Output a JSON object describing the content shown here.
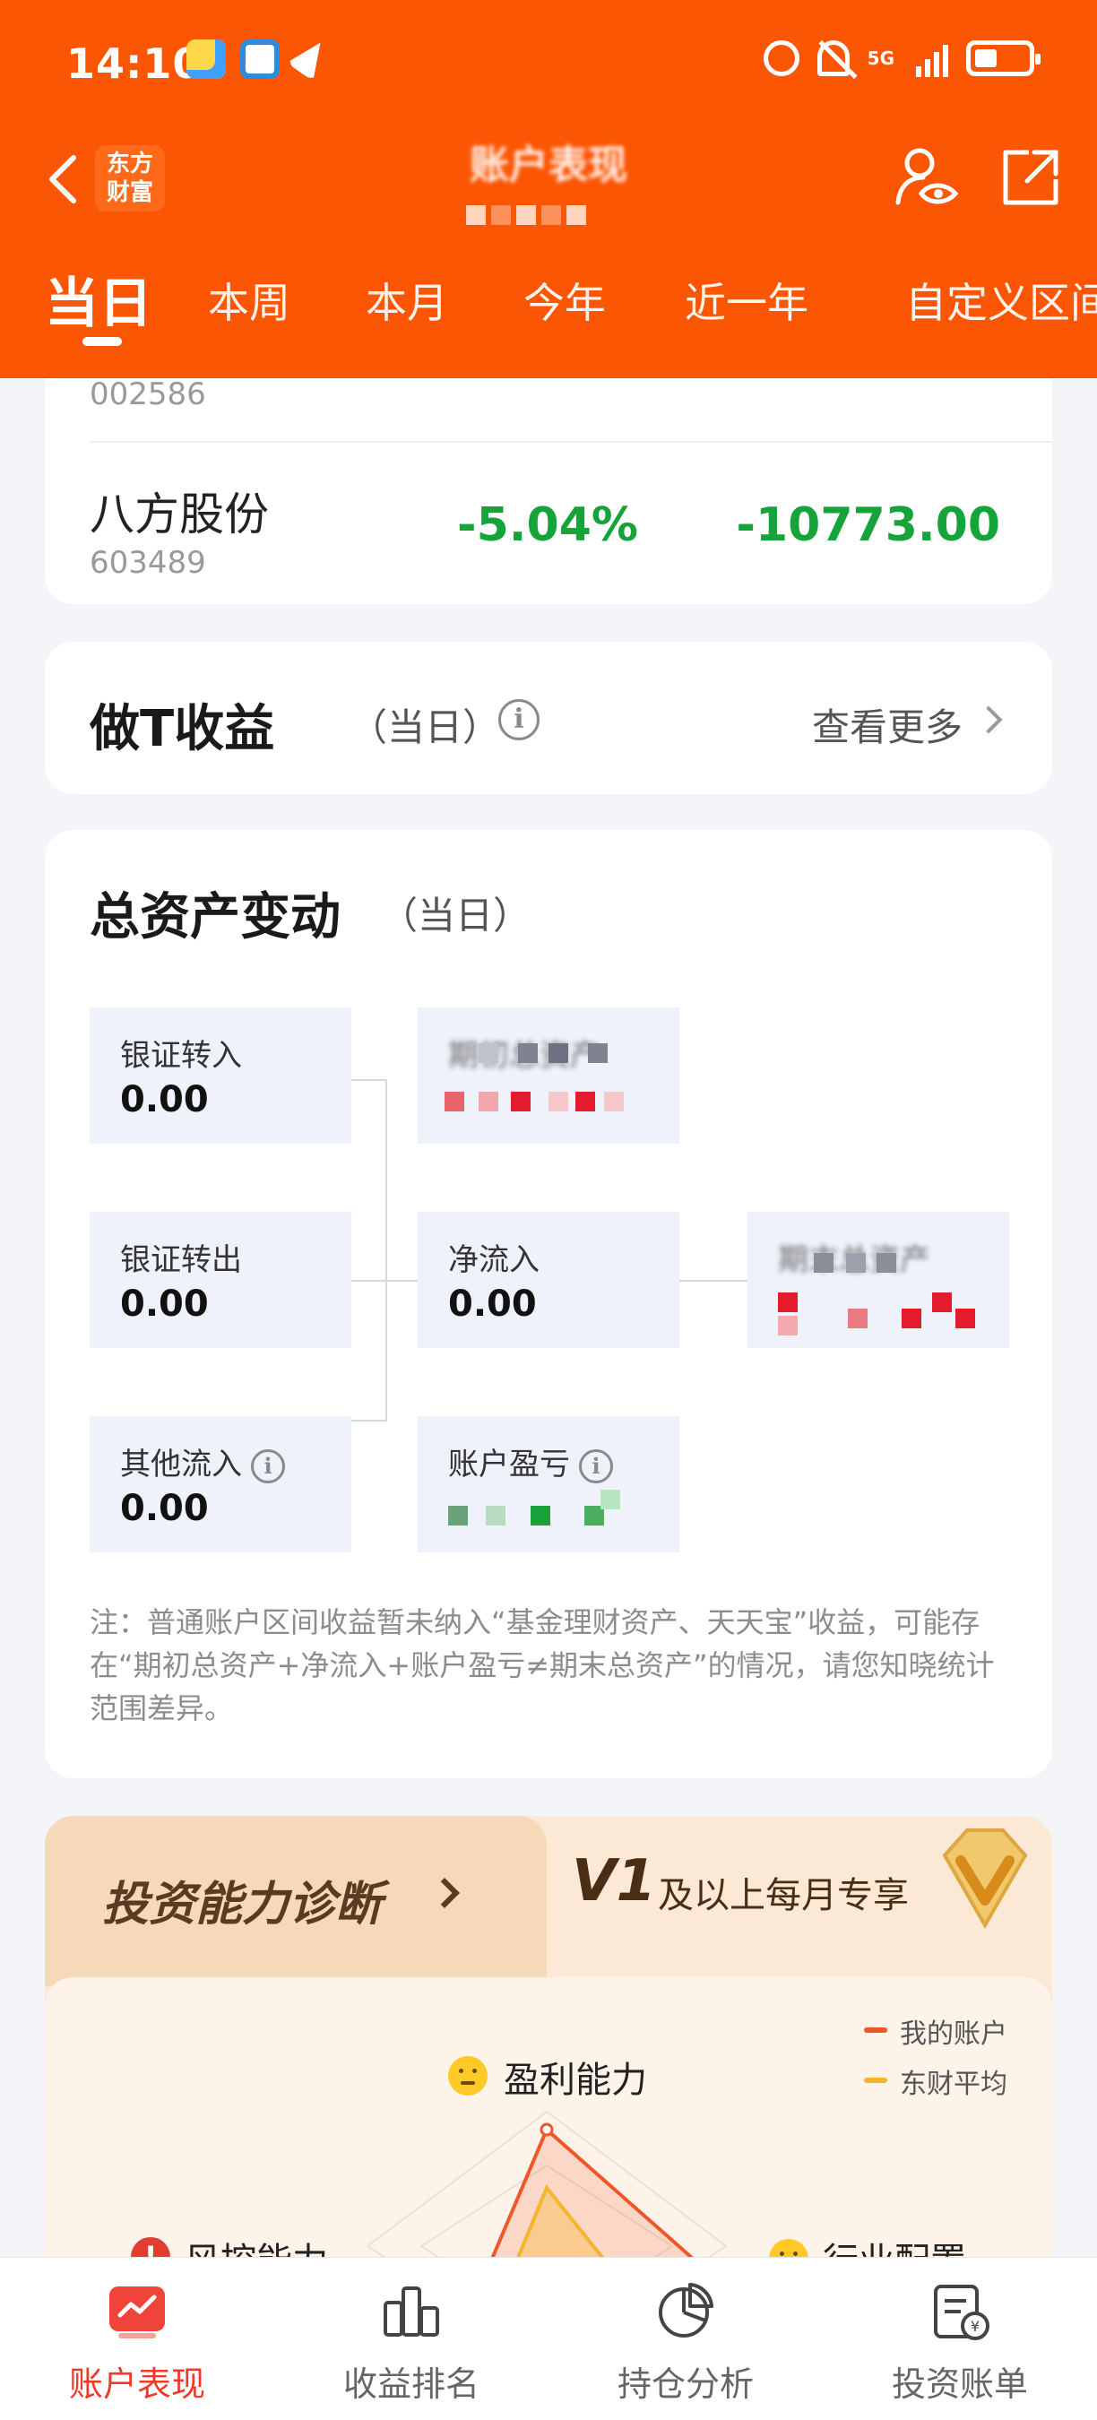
{
  "status_bar": {
    "time": "14:10",
    "network": "5G"
  },
  "nav": {
    "title": "账户表现",
    "brand_logo_text_line1": "东方",
    "brand_logo_text_line2": "财富"
  },
  "tabs": [
    {
      "label": "当日",
      "active": true
    },
    {
      "label": "本周",
      "active": false
    },
    {
      "label": "本月",
      "active": false
    },
    {
      "label": "今年",
      "active": false
    },
    {
      "label": "近一年",
      "active": false
    },
    {
      "label": "自定义区间",
      "active": false
    }
  ],
  "stocks": [
    {
      "name": "",
      "code": "002586",
      "pct": "",
      "amount": ""
    },
    {
      "name": "八方股份",
      "code": "603489",
      "pct": "-5.04%",
      "amount": "-10773.00"
    }
  ],
  "t_profit": {
    "title": "做T收益",
    "period": "（当日）",
    "more_label": "查看更多"
  },
  "asset_change": {
    "title": "总资产变动",
    "period": "（当日）",
    "boxes": {
      "bank_in": {
        "label": "银证转入",
        "value": "0.00"
      },
      "bank_out": {
        "label": "银证转出",
        "value": "0.00"
      },
      "other_in": {
        "label": "其他流入",
        "value": "0.00"
      },
      "net_inflow": {
        "label": "净流入",
        "value": "0.00"
      },
      "begin_total": {
        "label": "期初总资产",
        "value": ""
      },
      "end_total": {
        "label": "期末总资产",
        "value": ""
      },
      "account_pnl": {
        "label": "账户盈亏",
        "value": ""
      }
    },
    "note": "注：普通账户区间收益暂未纳入“基金理财资产、天天宝”收益，可能存在“期初总资产+净流入+账户盈亏≠期末总资产”的情况，请您知晓统计范围差异。"
  },
  "diagnosis": {
    "title": "投资能力诊断",
    "v_badge": "V1",
    "v_text": "及以上每月专享",
    "legend": [
      {
        "label": "我的账户",
        "color": "#f0562a"
      },
      {
        "label": "东财平均",
        "color": "#f5b52a"
      }
    ],
    "radar_labels": {
      "top": "盈利能力",
      "left": "风控能力",
      "right": "行业配置"
    }
  },
  "bottom_nav": [
    {
      "label": "账户表现",
      "active": true,
      "icon": "chart-trend-icon"
    },
    {
      "label": "收益排名",
      "active": false,
      "icon": "bar-ranking-icon"
    },
    {
      "label": "持仓分析",
      "active": false,
      "icon": "pie-chart-icon"
    },
    {
      "label": "投资账单",
      "active": false,
      "icon": "bill-icon"
    }
  ],
  "colors": {
    "brand_orange": "#fb5604",
    "loss_green": "#16a33a",
    "active_red": "#ee3a2b"
  }
}
